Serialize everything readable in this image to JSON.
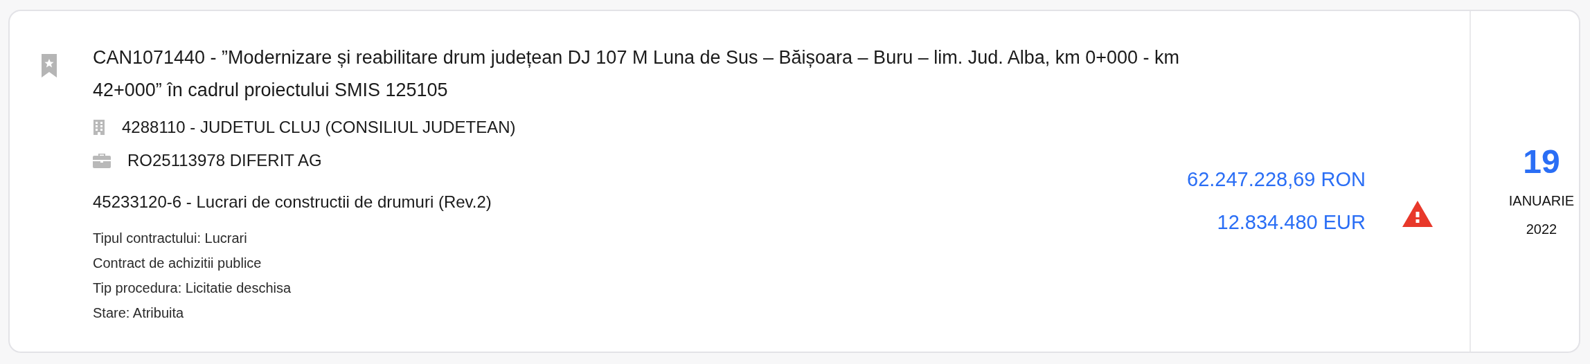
{
  "notice": {
    "title": "CAN1071440 - ”Modernizare și reabilitare drum județean DJ 107 M Luna de Sus – Băișoara – Buru – lim. Jud. Alba, km 0+000 - km 42+000” în cadrul proiectului SMIS 125105",
    "authority": "4288110 - JUDETUL CLUJ (CONSILIUL JUDETEAN)",
    "supplier": "RO25113978 DIFERIT AG",
    "cpv": "45233120-6 - Lucrari de constructii de drumuri (Rev.2)",
    "details": [
      "Tipul contractului: Lucrari",
      "Contract de achizitii publice",
      "Tip procedura: Licitatie deschisa",
      "Stare: Atribuita"
    ],
    "amounts": [
      "62.247.228,69 RON",
      "12.834.480 EUR"
    ],
    "warning": true,
    "date": {
      "day": "19",
      "month": "IANUARIE",
      "year": "2022"
    }
  }
}
